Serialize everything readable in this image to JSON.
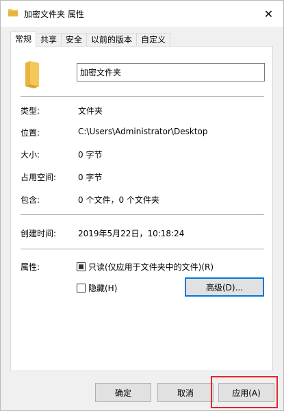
{
  "window": {
    "title": "加密文件夹 属性",
    "close_symbol": "✕"
  },
  "tabs": [
    {
      "label": "常规",
      "active": true
    },
    {
      "label": "共享",
      "active": false
    },
    {
      "label": "安全",
      "active": false
    },
    {
      "label": "以前的版本",
      "active": false
    },
    {
      "label": "自定义",
      "active": false
    }
  ],
  "general": {
    "folder_name": "加密文件夹",
    "rows": [
      {
        "label": "类型:",
        "value": "文件夹"
      },
      {
        "label": "位置:",
        "value": "C:\\Users\\Administrator\\Desktop"
      },
      {
        "label": "大小:",
        "value": "0 字节"
      },
      {
        "label": "占用空间:",
        "value": "0 字节"
      },
      {
        "label": "包含:",
        "value": "0 个文件，0 个文件夹"
      },
      {
        "label": "创建时间:",
        "value": "2019年5月22日，10:18:24"
      }
    ],
    "attributes_label": "属性:",
    "readonly_label": "只读(仅应用于文件夹中的文件)(R)",
    "readonly_state": "indeterminate",
    "hidden_label": "隐藏(H)",
    "hidden_state": "unchecked",
    "advanced_button": "高级(D)..."
  },
  "footer": {
    "ok": "确定",
    "cancel": "取消",
    "apply": "应用(A)"
  },
  "colors": {
    "highlight": "#e0282e",
    "focus_border": "#0078d7",
    "folder": "#f5c85a"
  }
}
